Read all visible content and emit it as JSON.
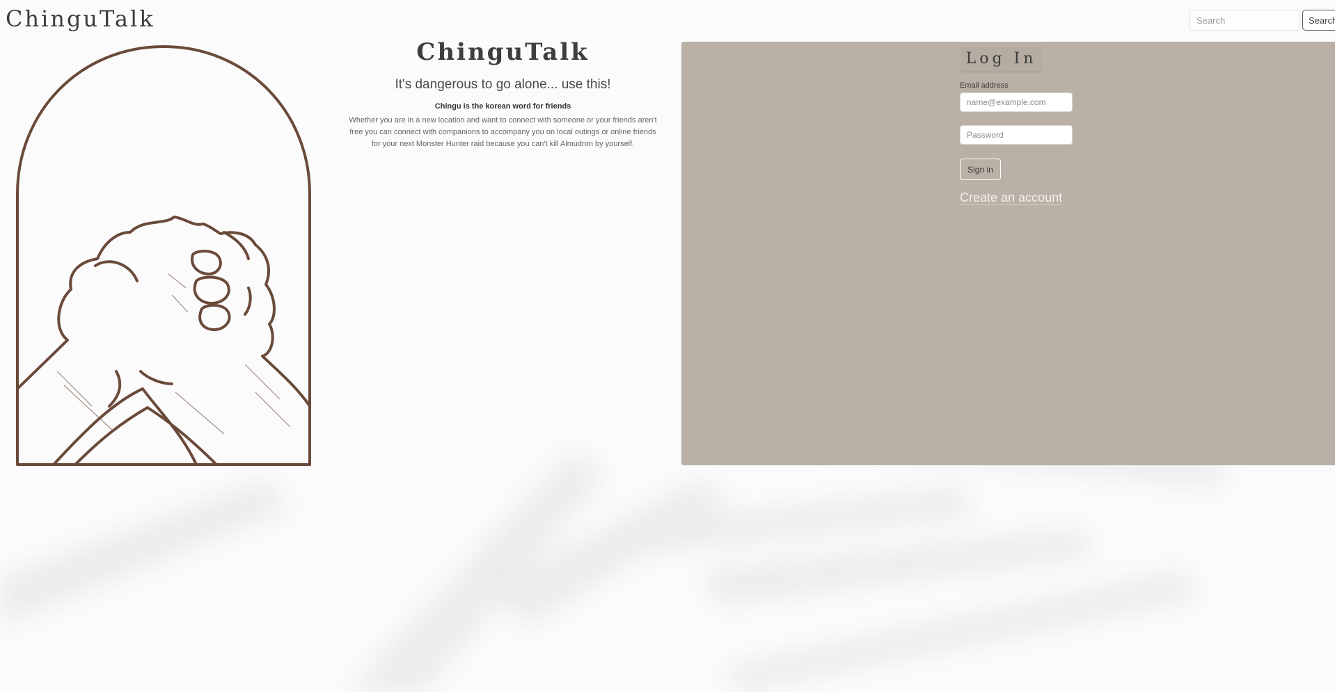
{
  "header": {
    "brand": "ChinguTalk",
    "search_placeholder": "Search",
    "search_button": "Search"
  },
  "hero": {
    "title": "ChinguTalk",
    "tagline": "It's dangerous to go alone... use this!",
    "subheading": "Chingu is the korean word for friends",
    "body": "Whether you are in a new location and want to connect with someone or your friends aren't free you can connect with companions to accompany you on local outings or online friends for your next Monster Hunter raid because you can't kill Almudron by yourself."
  },
  "login": {
    "title": "Log In",
    "email_label": "Email address",
    "email_placeholder": "name@example.com",
    "password_placeholder": "Password",
    "signin_button": "Sign in",
    "create_account": "Create an account"
  },
  "colors": {
    "panel": "#bab0a6",
    "artwork_stroke": "#6a4a3a"
  }
}
